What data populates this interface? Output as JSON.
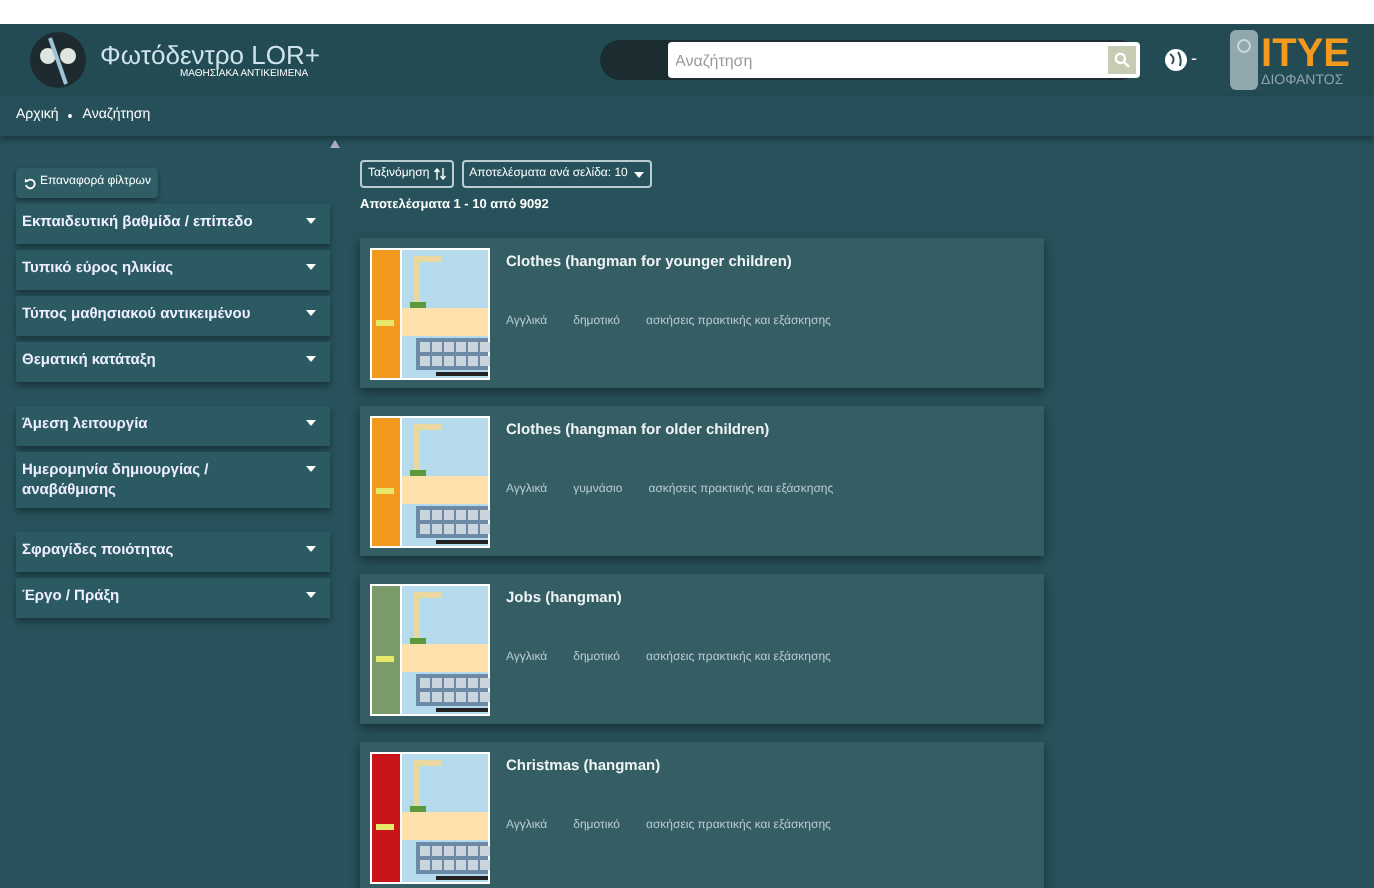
{
  "header": {
    "logo_title": "Φωτόδεντρο LOR+",
    "logo_subtitle": "ΜΑΘΗΣΙΑΚΑ ΑΝΤΙΚΕΙΜΕΝΑ",
    "search": {
      "placeholder": "Αναζήτηση"
    },
    "language_caret": "-",
    "partner_logo": "ΙΤΥΕ",
    "partner_subtitle": "ΔΙΟΦΑΝΤΟΣ"
  },
  "breadcrumb": [
    "Αρχική",
    "Αναζήτηση"
  ],
  "sidebar": {
    "reset_button": "Επαναφορά φίλτρων",
    "filter_groups": [
      [
        {
          "label": "Εκπαιδευτική βαθμίδα / επίπεδο"
        },
        {
          "label": "Τυπικό εύρος ηλικίας"
        },
        {
          "label": "Τύπος μαθησιακού αντικειμένου"
        },
        {
          "label": "Θεματική κατάταξη"
        }
      ],
      [
        {
          "label": "Άμεση λειτουργία"
        },
        {
          "label": "Ημερομηνία δημιουργίας / αναβάθμισης"
        }
      ],
      [
        {
          "label": "Σφραγίδες ποιότητας"
        },
        {
          "label": "Έργο / Πράξη"
        }
      ]
    ]
  },
  "toolbar": {
    "sort_button": "Ταξινόμηση",
    "per_page": "Αποτελέσματα ανά σελίδα: 10"
  },
  "results_count": "Αποτελέσματα 1 - 10 από 9092",
  "results": [
    {
      "title": "Clothes (hangman for younger children)",
      "tags": [
        "Αγγλικά",
        "δημοτικό",
        "ασκήσεις πρακτικής και εξάσκησης"
      ]
    },
    {
      "title": "Clothes (hangman for older children)",
      "tags": [
        "Αγγλικά",
        "γυμνάσιο",
        "ασκήσεις πρακτικής και εξάσκησης"
      ]
    },
    {
      "title": "Jobs (hangman)",
      "tags": [
        "Αγγλικά",
        "δημοτικό",
        "ασκήσεις πρακτικής και εξάσκησης"
      ]
    },
    {
      "title": "Christmas (hangman)",
      "tags": [
        "Αγγλικά",
        "δημοτικό",
        "ασκήσεις πρακτικής και εξάσκησης"
      ]
    }
  ]
}
